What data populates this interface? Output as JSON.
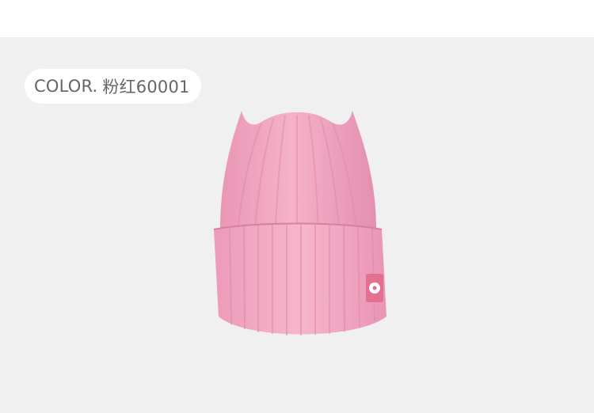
{
  "color_label": {
    "prefix": "COLOR.",
    "value": "粉红60001"
  },
  "product": {
    "image_icon": "pink-knit-beanie",
    "main_color": "#f3a5c1",
    "patch_color": "#e3708f"
  }
}
